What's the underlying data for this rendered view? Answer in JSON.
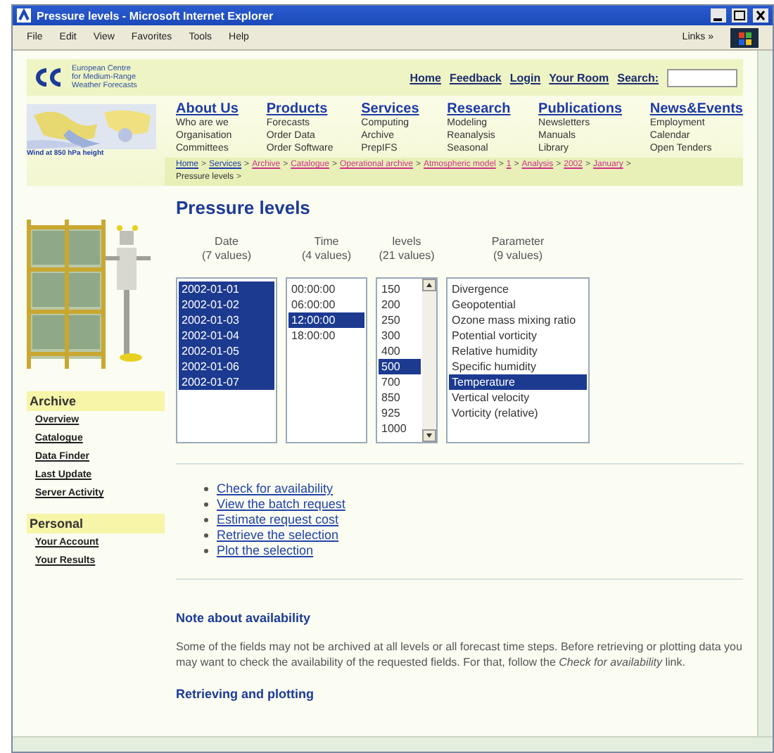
{
  "window": {
    "title": "Pressure levels - Microsoft Internet Explorer"
  },
  "menu": [
    "File",
    "Edit",
    "View",
    "Favorites",
    "Tools",
    "Help"
  ],
  "links_bar": {
    "label": "Links",
    "chevron": "»"
  },
  "logo": {
    "lines": [
      "European Centre",
      "for Medium-Range",
      "Weather Forecasts"
    ]
  },
  "map": {
    "caption": "Wind at 850 hPa height"
  },
  "top_links": [
    "Home",
    "Feedback",
    "Login",
    "Your Room"
  ],
  "search": {
    "label": "Search:"
  },
  "nav": [
    {
      "heading": "About Us",
      "items": [
        "Who are we",
        "Organisation",
        "Committees"
      ]
    },
    {
      "heading": "Products",
      "items": [
        "Forecasts",
        "Order Data",
        "Order Software"
      ]
    },
    {
      "heading": "Services",
      "items": [
        "Computing",
        "Archive",
        "PrepIFS"
      ]
    },
    {
      "heading": "Research",
      "items": [
        "Modeling",
        "Reanalysis",
        "Seasonal"
      ]
    },
    {
      "heading": "Publications",
      "items": [
        "Newsletters",
        "Manuals",
        "Library"
      ]
    },
    {
      "heading": "News&Events",
      "items": [
        "Employment",
        "Calendar",
        "Open Tenders"
      ]
    }
  ],
  "breadcrumb": {
    "separator": ">",
    "items": [
      {
        "text": "Home",
        "kind": "link",
        "visited": false
      },
      {
        "text": "Services",
        "kind": "link",
        "visited": false
      },
      {
        "text": "Archive",
        "kind": "link",
        "visited": true
      },
      {
        "text": "Catalogue",
        "kind": "link",
        "visited": true
      },
      {
        "text": "Operational archive",
        "kind": "link",
        "visited": true
      },
      {
        "text": "Atmospheric model",
        "kind": "link",
        "visited": true
      },
      {
        "text": "1",
        "kind": "link",
        "visited": true
      },
      {
        "text": "Analysis",
        "kind": "link",
        "visited": true
      },
      {
        "text": "2002",
        "kind": "link",
        "visited": true
      },
      {
        "text": "January",
        "kind": "link",
        "visited": true
      },
      {
        "text": "Pressure levels",
        "kind": "current"
      }
    ]
  },
  "sidebar": [
    {
      "heading": "Archive",
      "items": [
        "Overview",
        "Catalogue",
        "Data Finder",
        "Last Update",
        "Server Activity"
      ]
    },
    {
      "heading": "Personal",
      "items": [
        "Your Account",
        "Your Results"
      ]
    }
  ],
  "page_title": "Pressure levels",
  "selectors": [
    {
      "title": "Date",
      "count": "(7 values)",
      "scroll": false,
      "options": [
        {
          "label": "2002-01-01",
          "selected": true
        },
        {
          "label": "2002-01-02",
          "selected": true
        },
        {
          "label": "2002-01-03",
          "selected": true
        },
        {
          "label": "2002-01-04",
          "selected": true
        },
        {
          "label": "2002-01-05",
          "selected": true
        },
        {
          "label": "2002-01-06",
          "selected": true
        },
        {
          "label": "2002-01-07",
          "selected": true
        }
      ]
    },
    {
      "title": "Time",
      "count": "(4 values)",
      "scroll": false,
      "options": [
        {
          "label": "00:00:00",
          "selected": false
        },
        {
          "label": "06:00:00",
          "selected": false
        },
        {
          "label": "12:00:00",
          "selected": true
        },
        {
          "label": "18:00:00",
          "selected": false
        }
      ]
    },
    {
      "title": "levels",
      "count": "(21 values)",
      "scroll": true,
      "options": [
        {
          "label": "150",
          "selected": false
        },
        {
          "label": "200",
          "selected": false
        },
        {
          "label": "250",
          "selected": false
        },
        {
          "label": "300",
          "selected": false
        },
        {
          "label": "400",
          "selected": false
        },
        {
          "label": "500",
          "selected": true
        },
        {
          "label": "700",
          "selected": false
        },
        {
          "label": "850",
          "selected": false
        },
        {
          "label": "925",
          "selected": false
        },
        {
          "label": "1000",
          "selected": false
        }
      ]
    },
    {
      "title": "Parameter",
      "count": "(9 values)",
      "scroll": false,
      "options": [
        {
          "label": "Divergence",
          "selected": false
        },
        {
          "label": "Geopotential",
          "selected": false
        },
        {
          "label": "Ozone mass mixing ratio",
          "selected": false
        },
        {
          "label": "Potential vorticity",
          "selected": false
        },
        {
          "label": "Relative humidity",
          "selected": false
        },
        {
          "label": "Specific humidity",
          "selected": false
        },
        {
          "label": "Temperature",
          "selected": true
        },
        {
          "label": "Vertical velocity",
          "selected": false
        },
        {
          "label": "Vorticity (relative)",
          "selected": false
        }
      ]
    }
  ],
  "actions": [
    "Check for availability",
    "View the batch request",
    "Estimate request cost",
    "Retrieve the selection",
    "Plot the selection"
  ],
  "sections": [
    {
      "heading": "Note about availability",
      "text": "Some of the fields may not be archived at all levels or all forecast time steps. Before retrieving or plotting data you may want to check the availability of the requested fields. For that, follow the *Check for availability* link."
    },
    {
      "heading": "Retrieving and plotting"
    }
  ]
}
